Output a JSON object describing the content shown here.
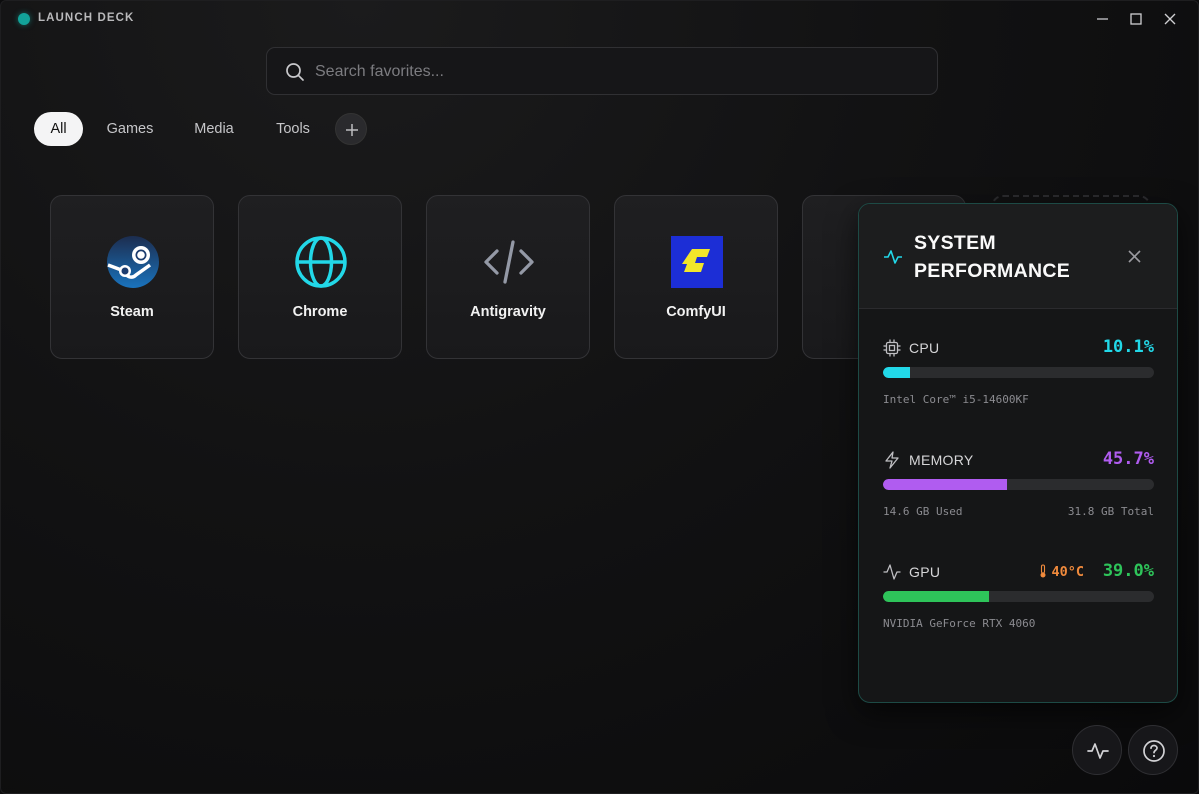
{
  "window": {
    "title": "LAUNCH DECK"
  },
  "search": {
    "placeholder": "Search favorites..."
  },
  "tabs": [
    {
      "label": "All",
      "active": true
    },
    {
      "label": "Games",
      "active": false
    },
    {
      "label": "Media",
      "active": false
    },
    {
      "label": "Tools",
      "active": false
    }
  ],
  "apps": [
    {
      "label": "Steam",
      "icon": "steam-icon"
    },
    {
      "label": "Chrome",
      "icon": "globe-icon"
    },
    {
      "label": "Antigravity",
      "icon": "code-icon"
    },
    {
      "label": "ComfyUI",
      "icon": "comfyui-icon"
    }
  ],
  "performance": {
    "title": "SYSTEM PERFORMANCE",
    "cpu": {
      "label": "CPU",
      "value": "10.1%",
      "percent": 10.1,
      "detail": "Intel Core™ i5-14600KF",
      "color": "#22d8e8"
    },
    "memory": {
      "label": "MEMORY",
      "value": "45.7%",
      "percent": 45.7,
      "used": "14.6 GB Used",
      "total": "31.8 GB Total",
      "color": "#b05cf0"
    },
    "gpu": {
      "label": "GPU",
      "value": "39.0%",
      "percent": 39.0,
      "temp": "40°C",
      "detail": "NVIDIA GeForce RTX 4060",
      "color": "#2ec45a"
    }
  },
  "colors": {
    "accent": "#12a39a",
    "cpu": "#22d8e8",
    "memory": "#b05cf0",
    "gpu": "#2ec45a",
    "temp": "#f08a3c"
  }
}
